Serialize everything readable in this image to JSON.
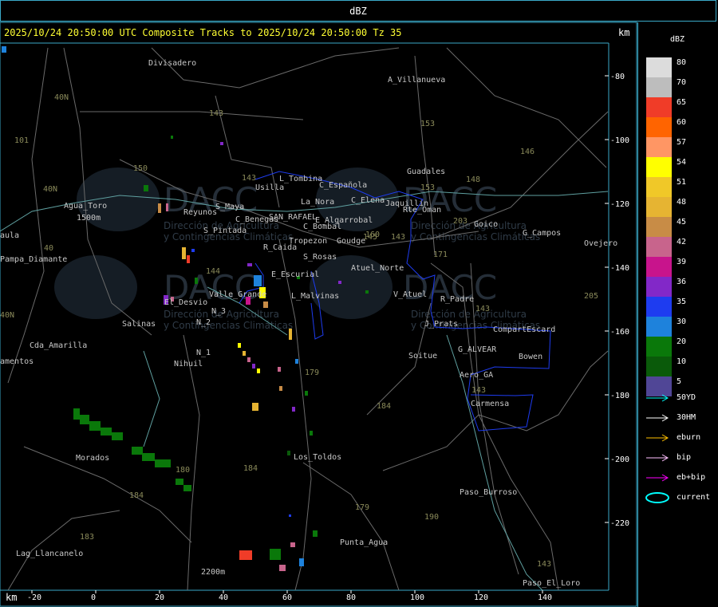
{
  "window": {
    "title": "dBZ"
  },
  "header": {
    "text": "2025/10/24 20:50:00 UTC Composite Tracks to 2025/10/24 20:50:00 Tz 35",
    "km_top": "km",
    "km_bottom": "km"
  },
  "watermark": {
    "brand": "DACC",
    "line1": "Dirección de Agricultura",
    "line2": "y Contingencias Climáticas"
  },
  "axes": {
    "x_ticks": [
      "-20",
      "0",
      "20",
      "40",
      "60",
      "80",
      "100",
      "120",
      "140"
    ],
    "y_ticks": [
      "-80",
      "-100",
      "-120",
      "-140",
      "-160",
      "-180",
      "-200",
      "-220"
    ]
  },
  "places": [
    {
      "name": "Divisadero"
    },
    {
      "name": "A_Villanueva"
    },
    {
      "name": "Guadales"
    },
    {
      "name": "L_Tombina"
    },
    {
      "name": "Usilla"
    },
    {
      "name": "C_Española"
    },
    {
      "name": "C_Elena"
    },
    {
      "name": "Jaquillin"
    },
    {
      "name": "Agua_Toro"
    },
    {
      "name": "Reyunos"
    },
    {
      "name": "S_Maya"
    },
    {
      "name": "La_Nora"
    },
    {
      "name": "C_Benegas"
    },
    {
      "name": "SAN_RAFAEL"
    },
    {
      "name": "E_Algarrobal"
    },
    {
      "name": "Rte_Oman"
    },
    {
      "name": "Goico"
    },
    {
      "name": "G_Campos"
    },
    {
      "name": "Ovejero"
    },
    {
      "name": "aula"
    },
    {
      "name": "S_Pintada"
    },
    {
      "name": "C_Bombal"
    },
    {
      "name": "Tropezon"
    },
    {
      "name": "Goudge"
    },
    {
      "name": "R_Caida"
    },
    {
      "name": "S_Rosas"
    },
    {
      "name": "Pampa_Diamante"
    },
    {
      "name": "Atuel_Norte"
    },
    {
      "name": "E_Escurial"
    },
    {
      "name": "Valle_Grande"
    },
    {
      "name": "L_Malvinas"
    },
    {
      "name": "V_Atuel"
    },
    {
      "name": "R_Padre"
    },
    {
      "name": "El_Desvio"
    },
    {
      "name": "Salinas"
    },
    {
      "name": "N_3"
    },
    {
      "name": "N_2"
    },
    {
      "name": "J_Prats"
    },
    {
      "name": "CompartEscard"
    },
    {
      "name": "Cda_Amarilla"
    },
    {
      "name": "N_1"
    },
    {
      "name": "G_ALVEAR"
    },
    {
      "name": "Soitue"
    },
    {
      "name": "Bowen"
    },
    {
      "name": "amentos"
    },
    {
      "name": "Nihuil"
    },
    {
      "name": "Aero_GA"
    },
    {
      "name": "Carmensa"
    },
    {
      "name": "Morados"
    },
    {
      "name": "Los_Toldos"
    },
    {
      "name": "Paso_Burroso"
    },
    {
      "name": "Punta_Agua"
    },
    {
      "name": "Lag_Llancanelo"
    },
    {
      "name": "Paso_El_Loro"
    },
    {
      "name": "1500m"
    },
    {
      "name": "2200m"
    }
  ],
  "route_numbers": [
    "143",
    "153",
    "146",
    "101",
    "40N",
    "150",
    "143",
    "148",
    "203",
    "40N",
    "171",
    "144",
    "143",
    "205",
    "40",
    "145",
    "179",
    "184",
    "180",
    "184",
    "184",
    "183",
    "190",
    "179",
    "143",
    "143",
    "153",
    "143",
    "160",
    "40N"
  ],
  "legend": {
    "title": "dBZ",
    "scale": [
      {
        "value": "80",
        "color": "#dcdcdc"
      },
      {
        "value": "70",
        "color": "#bdbdbd"
      },
      {
        "value": "65",
        "color": "#f03c28"
      },
      {
        "value": "60",
        "color": "#ff6400"
      },
      {
        "value": "57",
        "color": "#ff9664"
      },
      {
        "value": "54",
        "color": "#ffff00"
      },
      {
        "value": "51",
        "color": "#f0c828"
      },
      {
        "value": "48",
        "color": "#e6b432"
      },
      {
        "value": "45",
        "color": "#c88c46"
      },
      {
        "value": "42",
        "color": "#c8648c"
      },
      {
        "value": "39",
        "color": "#c8148c"
      },
      {
        "value": "36",
        "color": "#8228c8"
      },
      {
        "value": "35",
        "color": "#1e3cf0"
      },
      {
        "value": "30",
        "color": "#1e82dc"
      },
      {
        "value": "20",
        "color": "#0a780a"
      },
      {
        "value": "10",
        "color": "#0a5a0a"
      },
      {
        "value": "5",
        "color": "#504696"
      }
    ],
    "tracks": [
      {
        "label": "50YD",
        "color": "#00ffff"
      },
      {
        "label": "30HM",
        "color": "#ffffff"
      },
      {
        "label": "eburn",
        "color": "#ffc000"
      },
      {
        "label": "bip",
        "color": "#ffc0ff"
      },
      {
        "label": "eb+bip",
        "color": "#ff00ff"
      },
      {
        "label": "current",
        "color": "#00ffff"
      }
    ]
  }
}
